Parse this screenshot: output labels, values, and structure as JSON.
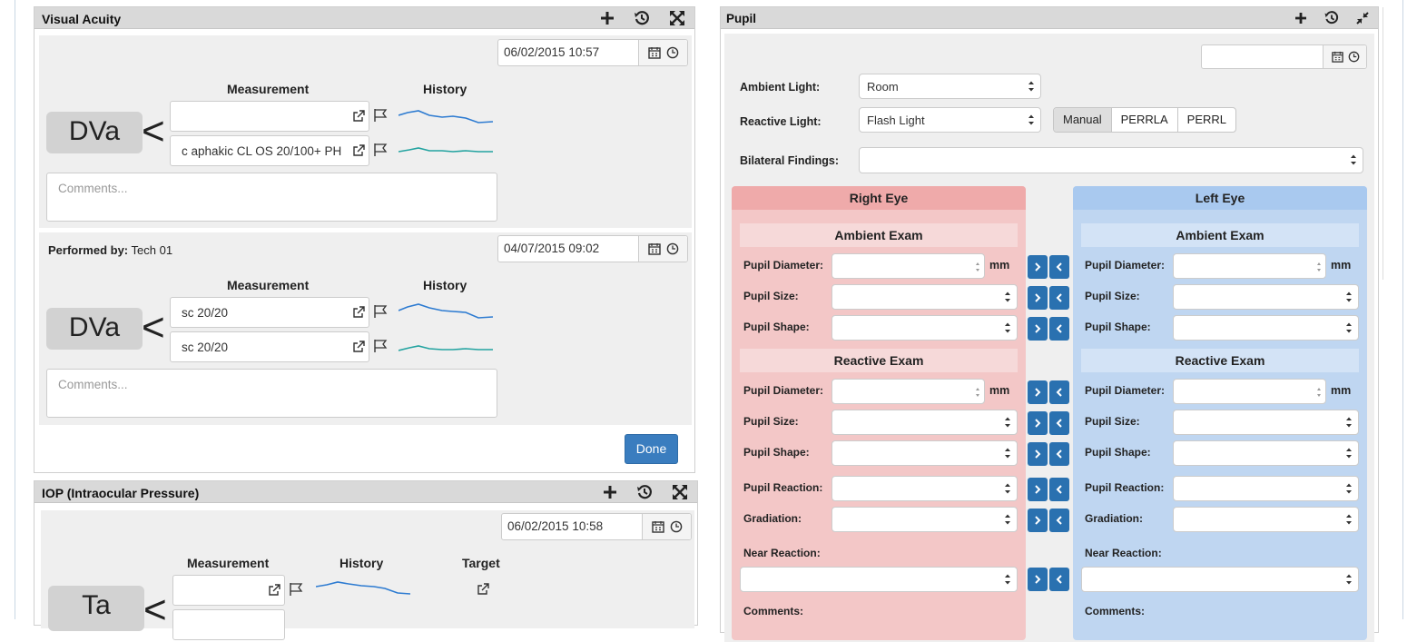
{
  "visual_acuity": {
    "title": "Visual Acuity",
    "entry1": {
      "date": "06/02/2015 10:57",
      "measurement_header": "Measurement",
      "history_header": "History",
      "label": "DVa",
      "symbol": "<",
      "measurement_1": "",
      "measurement_2": "c aphakic CL OS  20/100+ PH",
      "comments_placeholder": "Comments..."
    },
    "entry2": {
      "performed_by_label": "Performed by:",
      "performed_by": "Tech 01",
      "date": "04/07/2015 09:02",
      "measurement_header": "Measurement",
      "history_header": "History",
      "label": "DVa",
      "symbol": "<",
      "measurement_1": "sc 20/20",
      "measurement_2": "sc 20/20",
      "comments_placeholder": "Comments..."
    },
    "done_label": "Done"
  },
  "iop": {
    "title": "IOP (Intraocular Pressure)",
    "date": "06/02/2015 10:58",
    "measurement_header": "Measurement",
    "history_header": "History",
    "target_header": "Target",
    "label": "Ta",
    "symbol": "<",
    "measurement_1": ""
  },
  "pupil": {
    "title": "Pupil",
    "date": "",
    "ambient_light_label": "Ambient Light:",
    "ambient_light_value": "Room",
    "reactive_light_label": "Reactive Light:",
    "reactive_light_value": "Flash Light",
    "mode_buttons": [
      "Manual",
      "PERRLA",
      "PERRL"
    ],
    "mode_selected": "Manual",
    "bilateral_label": "Bilateral Findings:",
    "bilateral_value": "",
    "right_eye": {
      "title": "Right Eye",
      "ambient_exam": "Ambient Exam",
      "reactive_exam": "Reactive Exam",
      "pupil_diameter": "Pupil Diameter:",
      "pupil_size": "Pupil Size:",
      "pupil_shape": "Pupil Shape:",
      "pupil_reaction": "Pupil Reaction:",
      "gradiation": "Gradiation:",
      "near_reaction": "Near Reaction:",
      "comments": "Comments:",
      "unit": "mm"
    },
    "left_eye": {
      "title": "Left Eye",
      "ambient_exam": "Ambient Exam",
      "reactive_exam": "Reactive Exam",
      "pupil_diameter": "Pupil Diameter:",
      "pupil_size": "Pupil Size:",
      "pupil_shape": "Pupil Shape:",
      "pupil_reaction": "Pupil Reaction:",
      "gradiation": "Gradiation:",
      "near_reaction": "Near Reaction:",
      "comments": "Comments:",
      "unit": "mm"
    }
  },
  "icons": {
    "add": "plus-icon",
    "history": "history-icon",
    "expand": "expand-icon",
    "collapse": "collapse-icon",
    "calendar": "calendar-icon",
    "clock": "clock-icon",
    "external": "external-link-icon",
    "flag": "flag-icon",
    "copy_right": "chevron-right-icon",
    "copy_left": "chevron-left-icon"
  },
  "colors": {
    "right_eye_bg": "#f3c7c7",
    "right_eye_header": "#efaaaa",
    "left_eye_bg": "#bfd6f1",
    "left_eye_header": "#a9c9ef",
    "copy_button": "#2a71b0",
    "done_button": "#3a7dbf",
    "spark_blue": "#2d7bd1",
    "spark_teal": "#23a3a0"
  }
}
